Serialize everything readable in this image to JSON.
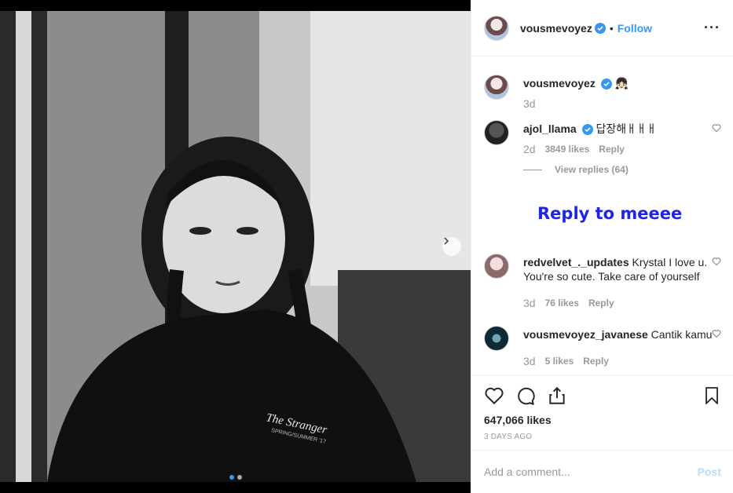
{
  "post": {
    "username": "vousmevoyez",
    "follow_label": "Follow",
    "separator": "•",
    "more_label": "···",
    "likes_text": "647,066 likes",
    "time_ago": "3 DAYS AGO",
    "photo_caption_text": "The Stranger",
    "photo_caption_sub": "SPRING/SUMMER '17"
  },
  "caption": {
    "username": "vousmevoyez",
    "emoji": "👧🏻",
    "time": "3d"
  },
  "comments": [
    {
      "username": "ajol_llama",
      "verified": true,
      "text": "답장해ㅐㅐㅐ",
      "time": "2d",
      "likes": "3849 likes",
      "reply": "Reply",
      "view_replies": "View replies (64)"
    },
    {
      "username": "redvelvet_._updates",
      "verified": false,
      "text": "Krystal I love u. You're so cute. Take care of yourself",
      "time": "3d",
      "likes": "76 likes",
      "reply": "Reply"
    },
    {
      "username": "vousmevoyez_javanese",
      "verified": false,
      "text": "Cantik kamu",
      "time": "3d",
      "likes": "5 likes",
      "reply": "Reply"
    }
  ],
  "overlay_text": "Reply to meeee",
  "add_comment": {
    "placeholder": "Add a comment...",
    "post_label": "Post"
  },
  "colors": {
    "link_blue": "#3897f0",
    "overlay_blue": "#1e24e8",
    "post_disabled": "#b2dffc"
  },
  "icons": [
    "verified-badge-icon",
    "heart-icon",
    "comment-icon",
    "share-icon",
    "bookmark-icon",
    "chevron-right-icon",
    "more-icon"
  ]
}
